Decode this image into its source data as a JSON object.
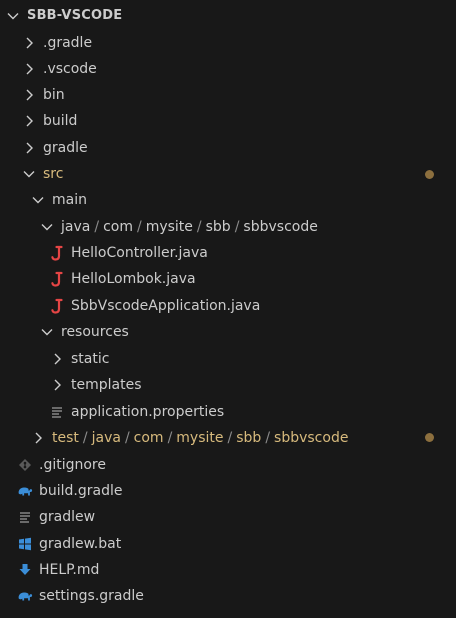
{
  "explorer": {
    "root_label": "SBB-VSCODE",
    "folders": {
      "gradle_dir": ".gradle",
      "vscode_dir": ".vscode",
      "bin": "bin",
      "build": "build",
      "gradle": "gradle",
      "src": "src",
      "main": "main",
      "java_path": [
        "java",
        "com",
        "mysite",
        "sbb",
        "sbbvscode"
      ],
      "resources": "resources",
      "static": "static",
      "templates": "templates",
      "test_path": [
        "test",
        "java",
        "com",
        "mysite",
        "sbb",
        "sbbvscode"
      ]
    },
    "java_files": [
      "HelloController.java",
      "HelloLombok.java",
      "SbbVscodeApplication.java"
    ],
    "files": {
      "application_properties": "application.properties",
      "gitignore": ".gitignore",
      "build_gradle": "build.gradle",
      "gradlew": "gradlew",
      "gradlew_bat": "gradlew.bat",
      "help_md": "HELP.md",
      "settings_gradle": "settings.gradle"
    },
    "path_separator": "/",
    "colors": {
      "background": "#181818",
      "text": "#cccccc",
      "modified": "#d7ba7d",
      "modified_dot": "#8c6f3e",
      "java_icon": "#e54545",
      "gradle_icon": "#3b8ed8",
      "windows_icon": "#3b8ed8",
      "markdown_icon": "#3b8ed8",
      "lines_icon": "#9a9a9a"
    }
  }
}
